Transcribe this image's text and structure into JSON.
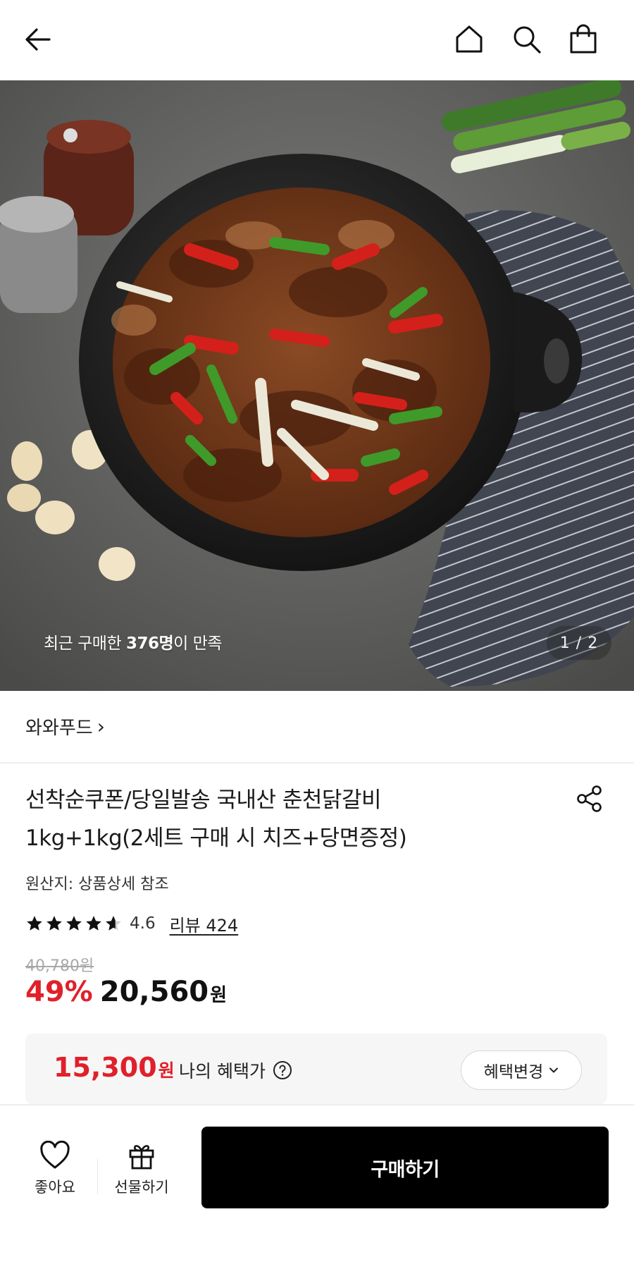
{
  "header": {
    "icons": [
      "back-arrow-icon",
      "home-icon",
      "search-icon",
      "shopping-bag-icon"
    ]
  },
  "hero": {
    "satisfied_prefix": "최근 구매한 ",
    "satisfied_count": "376명",
    "satisfied_suffix": "이 만족",
    "pager": "1 / 2"
  },
  "brand": {
    "name": "와와푸드",
    "chevron": "›"
  },
  "product": {
    "title_line1": "선착순쿠폰/당일발송 국내산 춘천닭갈비",
    "title_line2": "1kg+1kg(2세트 구매 시 치즈+당면증정)",
    "origin": "원산지: 상품상세 참조",
    "rating": "4.6",
    "rating_value": 4.6,
    "reviews": "리뷰 424",
    "original_price": "40,780원",
    "discount": "49%",
    "price": "20,560",
    "price_unit": "원"
  },
  "benefit": {
    "price": "15,300",
    "unit": "원",
    "label": "나의 혜택가",
    "change_button": "혜택변경"
  },
  "bottom_bar": {
    "like_label": "좋아요",
    "gift_label": "선물하기",
    "buy_label": "구매하기"
  },
  "colors": {
    "accent_red": "#e0202a",
    "buy_button": "#000000"
  }
}
